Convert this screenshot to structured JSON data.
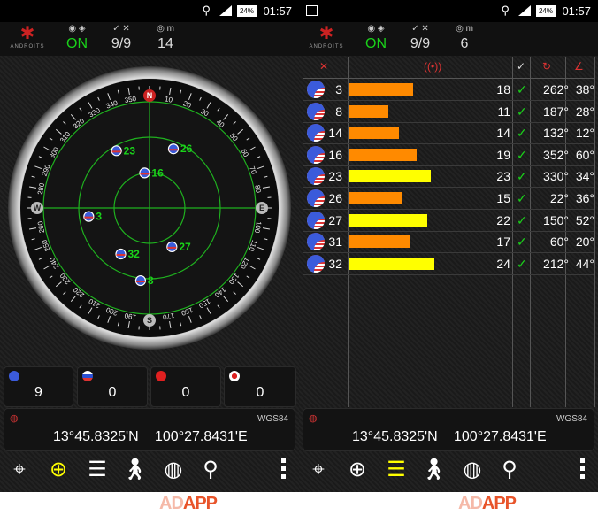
{
  "status_bar": {
    "time": "01:57",
    "battery": "24%"
  },
  "app_logo": {
    "text": "ANDROITS"
  },
  "toolbar": {
    "gps_state": "ON",
    "sats_fix": "9/9",
    "m_label": "m",
    "left_accuracy": "14",
    "right_accuracy": "6"
  },
  "radar": {
    "compass_labels": [
      "N",
      "E",
      "S",
      "W"
    ],
    "degree_ticks": [
      "340",
      "330",
      "320",
      "310",
      "300",
      "290",
      "280",
      "260",
      "250",
      "240",
      "230",
      "220",
      "210",
      "200",
      "190",
      "170",
      "160",
      "150",
      "140",
      "130",
      "120",
      "110",
      "100",
      "80",
      "70",
      "60",
      "50",
      "40",
      "30",
      "20",
      "10",
      "350"
    ],
    "satellites": [
      {
        "prn": "23",
        "az": 330,
        "el": 34
      },
      {
        "prn": "26",
        "az": 22,
        "el": 36
      },
      {
        "prn": "16",
        "az": 352,
        "el": 60
      },
      {
        "prn": "3",
        "az": 262,
        "el": 38
      },
      {
        "prn": "27",
        "az": 150,
        "el": 52
      },
      {
        "prn": "32",
        "az": 212,
        "el": 44
      },
      {
        "prn": "8",
        "az": 187,
        "el": 28
      }
    ]
  },
  "gnss_counts": [
    {
      "system": "gps",
      "flag_color": "#3b5bdb",
      "count": "9"
    },
    {
      "system": "glonass",
      "flag_color": "#d33",
      "count": "0"
    },
    {
      "system": "beidou",
      "flag_color": "#e02020",
      "count": "0"
    },
    {
      "system": "qzss",
      "flag_color": "#ffffff",
      "count": "0"
    }
  ],
  "position": {
    "latitude": "13°45.8325'N",
    "longitude": "100°27.8431'E",
    "datum": "WGS84"
  },
  "navbar": {
    "items": [
      "compass-icon",
      "radar-icon",
      "signal-bars-icon",
      "walk-icon",
      "globe-icon",
      "map-pin-icon"
    ]
  },
  "watermark": {
    "ad": "AD",
    "app": "APP"
  },
  "sat_table": {
    "rows": [
      {
        "prn": "3",
        "snr": "18",
        "az": "262°",
        "el": "38°",
        "snr_value": 18,
        "color": "#ff8a00"
      },
      {
        "prn": "8",
        "snr": "11",
        "az": "187°",
        "el": "28°",
        "snr_value": 11,
        "color": "#ff8a00"
      },
      {
        "prn": "14",
        "snr": "14",
        "az": "132°",
        "el": "12°",
        "snr_value": 14,
        "color": "#ff8a00"
      },
      {
        "prn": "16",
        "snr": "19",
        "az": "352°",
        "el": "60°",
        "snr_value": 19,
        "color": "#ff8a00"
      },
      {
        "prn": "23",
        "snr": "23",
        "az": "330°",
        "el": "34°",
        "snr_value": 23,
        "color": "#ffff00"
      },
      {
        "prn": "26",
        "snr": "15",
        "az": "22°",
        "el": "36°",
        "snr_value": 15,
        "color": "#ff8a00"
      },
      {
        "prn": "27",
        "snr": "22",
        "az": "150°",
        "el": "52°",
        "snr_value": 22,
        "color": "#ffff00"
      },
      {
        "prn": "31",
        "snr": "17",
        "az": "60°",
        "el": "20°",
        "snr_value": 17,
        "color": "#ff8a00"
      },
      {
        "prn": "32",
        "snr": "24",
        "az": "212°",
        "el": "44°",
        "snr_value": 24,
        "color": "#ffff00"
      }
    ]
  },
  "colors": {
    "accent_green": "#1ad21a",
    "grid_green": "#1fb01f",
    "icon_red": "#d33"
  }
}
